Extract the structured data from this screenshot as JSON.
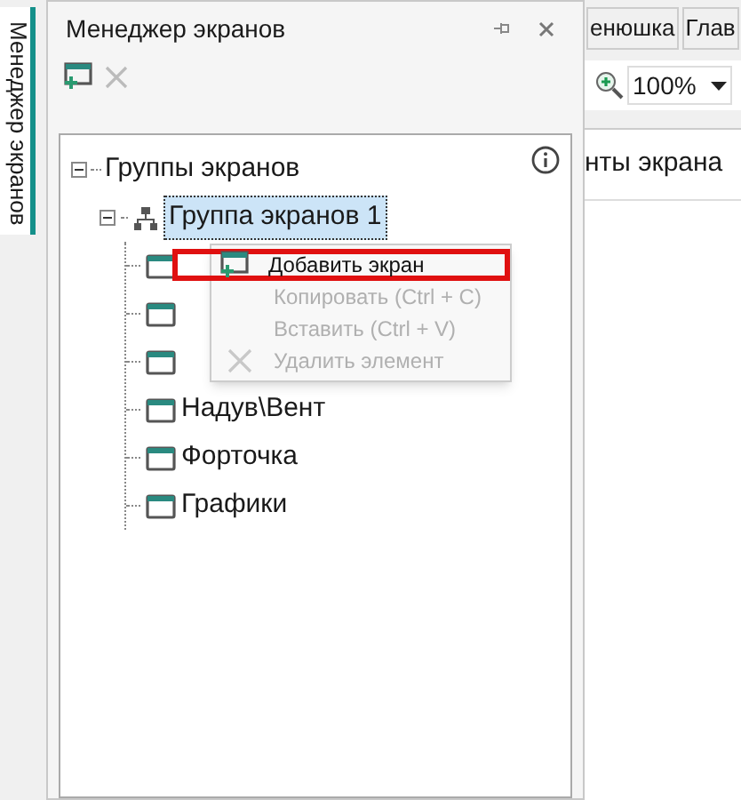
{
  "side_tab": {
    "label": "Менеджер экранов",
    "selected": true
  },
  "panel": {
    "title": "Менеджер экранов"
  },
  "tree": {
    "label": "Группы экранов",
    "expanded": true,
    "children": [
      {
        "label": "Группа экранов 1",
        "expanded": true,
        "selected": true,
        "children": [
          {
            "kind": "screen"
          },
          {
            "kind": "screen"
          },
          {
            "kind": "screen"
          },
          {
            "kind": "screen",
            "label": "Надув\\Вент"
          },
          {
            "kind": "screen",
            "label": "Форточка"
          },
          {
            "kind": "screen",
            "label": "Графики"
          }
        ]
      }
    ]
  },
  "context_menu": [
    {
      "label": "Добавить экран",
      "kind": "add",
      "disabled": false,
      "highlighted": true
    },
    {
      "label": "Копировать (Ctrl + C)",
      "kind": "plain",
      "disabled": true,
      "highlighted": false
    },
    {
      "label": "Вставить (Ctrl + V)",
      "kind": "plain",
      "disabled": true,
      "highlighted": false
    },
    {
      "label": "Удалить элемент",
      "kind": "delete",
      "disabled": true,
      "highlighted": false
    }
  ],
  "doc_tabs": [
    {
      "label": "енюшка"
    },
    {
      "label": "Глав"
    }
  ],
  "zoom": {
    "value": "100%"
  },
  "section_title": "нты экрана"
}
